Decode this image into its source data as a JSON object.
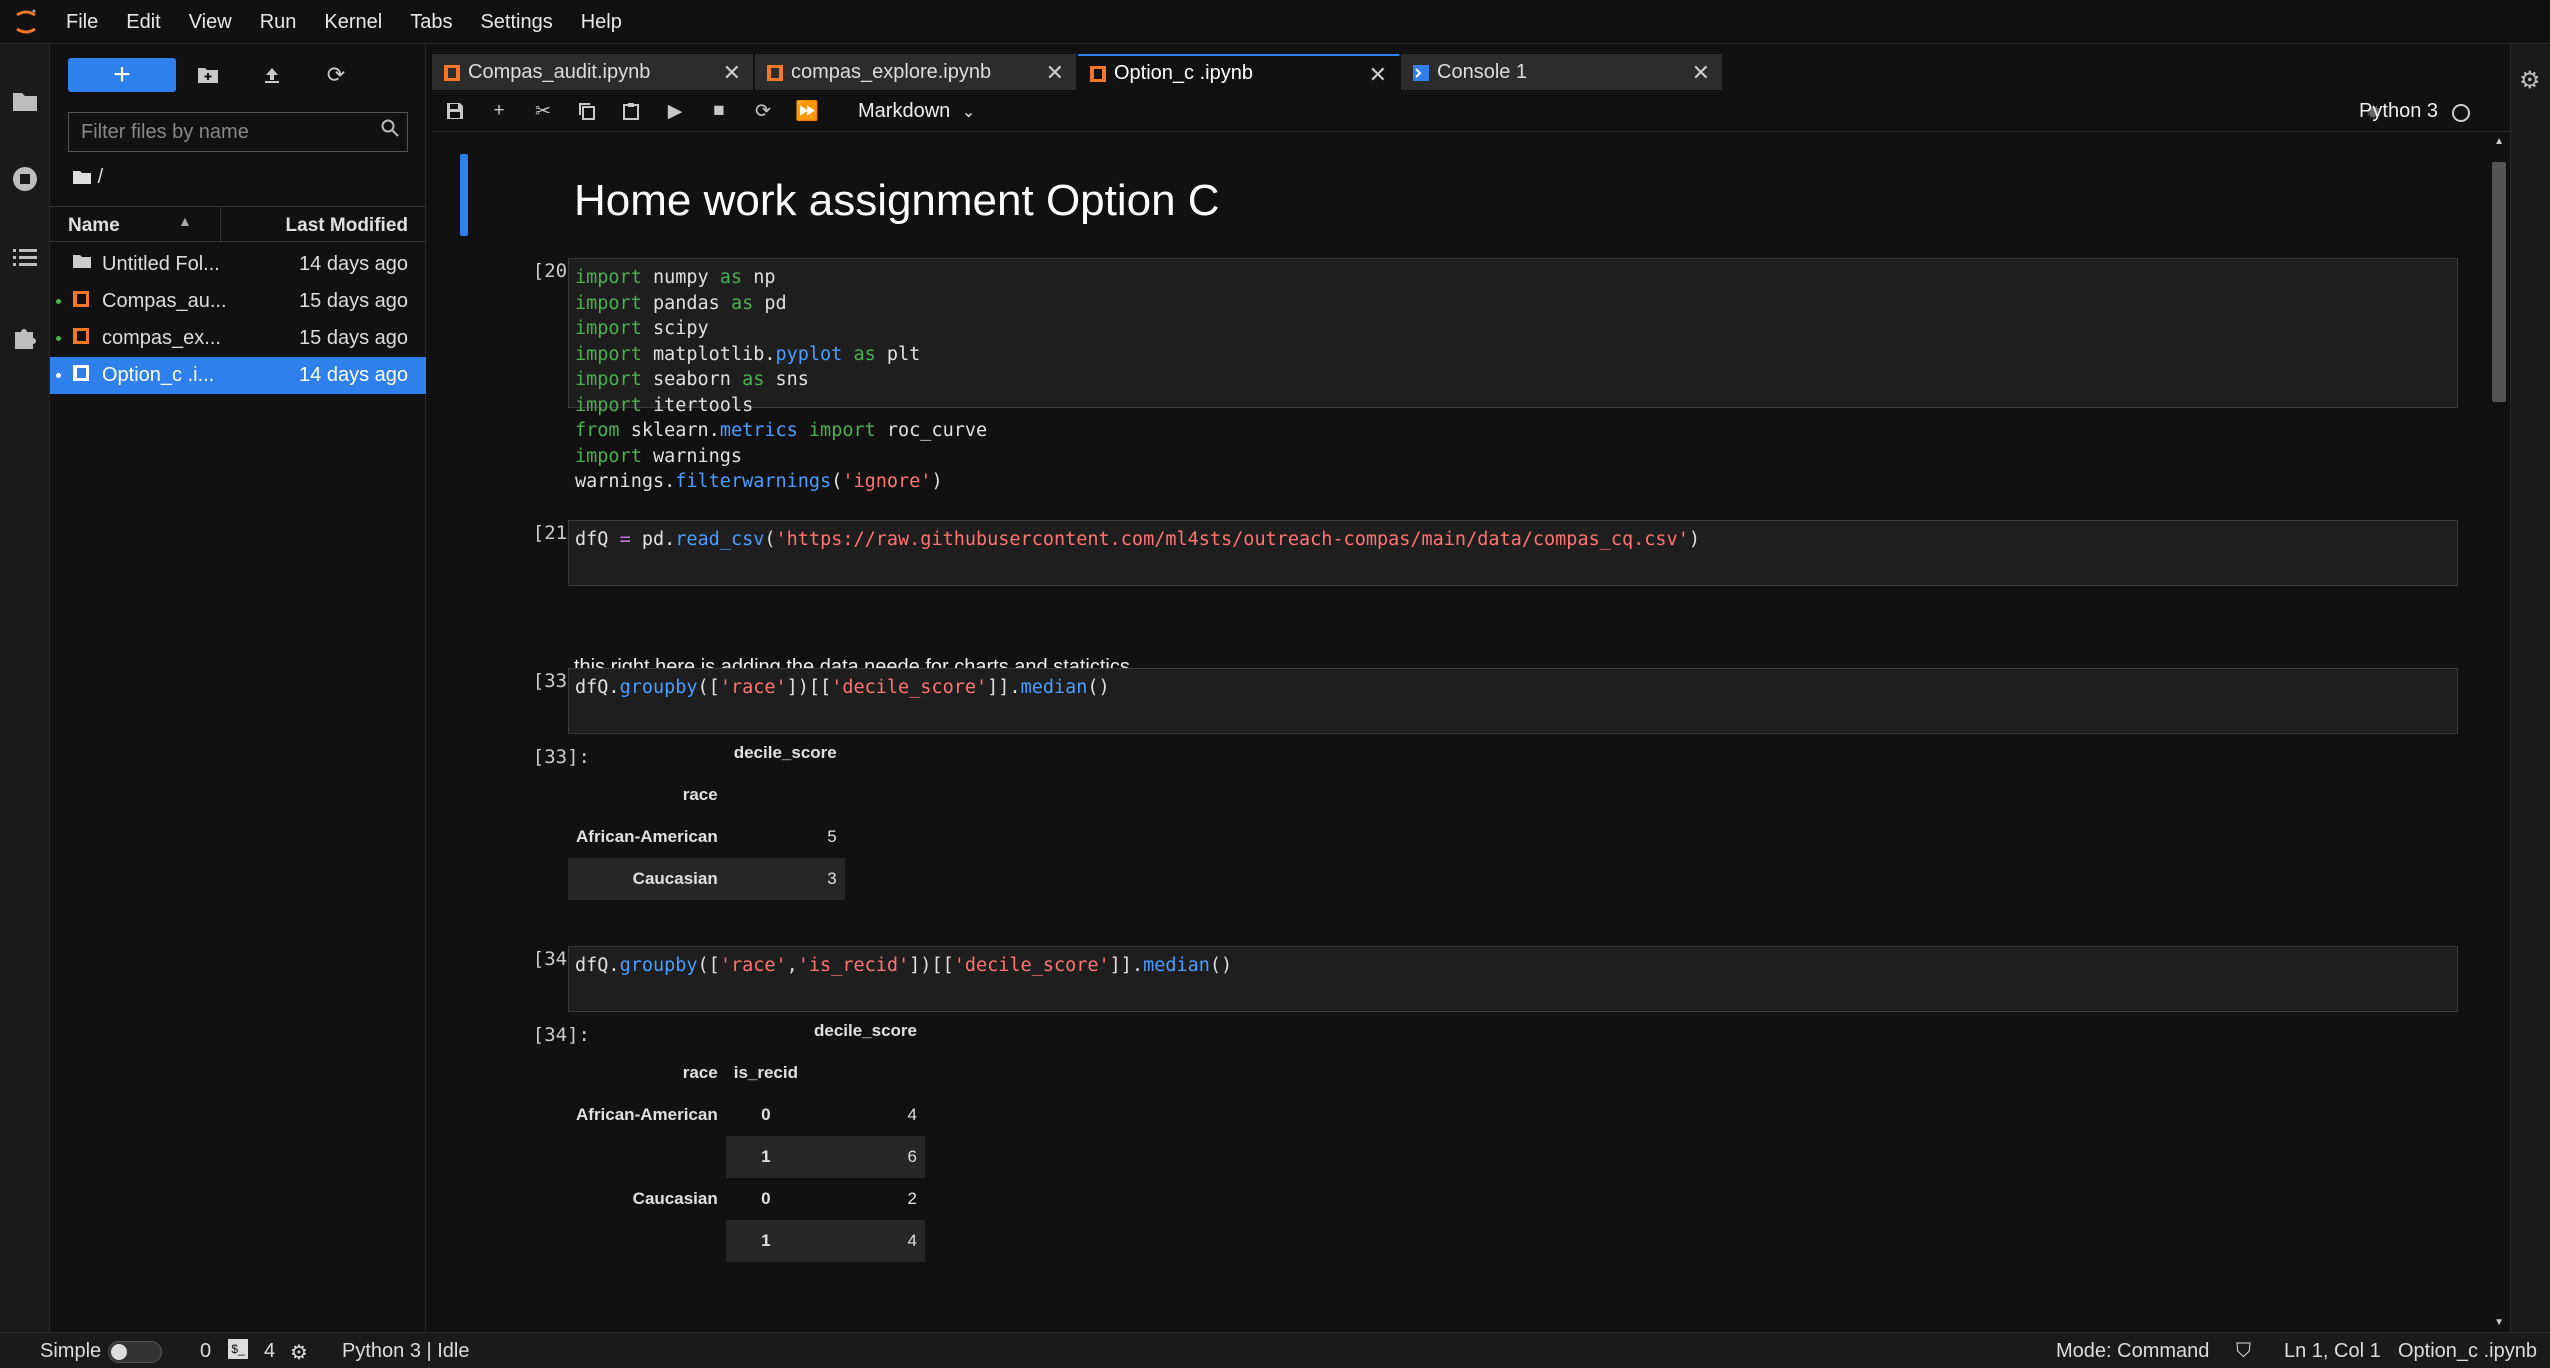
{
  "menubar": {
    "items": [
      "File",
      "Edit",
      "View",
      "Run",
      "Kernel",
      "Tabs",
      "Settings",
      "Help"
    ]
  },
  "filebrowser": {
    "filter_placeholder": "Filter files by name",
    "breadcrumb": "/",
    "col_name": "Name",
    "col_modified": "Last Modified",
    "files": [
      {
        "name": "Untitled Fol...",
        "modified": "14 days ago",
        "type": "folder"
      },
      {
        "name": "Compas_au...",
        "modified": "15 days ago",
        "type": "notebook"
      },
      {
        "name": "compas_ex...",
        "modified": "15 days ago",
        "type": "notebook"
      },
      {
        "name": "Option_c .i...",
        "modified": "14 days ago",
        "type": "notebook"
      }
    ]
  },
  "tabs": [
    {
      "label": "Compas_audit.ipynb"
    },
    {
      "label": "compas_explore.ipynb"
    },
    {
      "label": "Option_c .ipynb"
    },
    {
      "label": "Console 1"
    }
  ],
  "toolbar": {
    "cell_type": "Markdown",
    "kernel": "Python 3"
  },
  "notebook": {
    "heading": "Home work assignment Option C",
    "prompts": {
      "p20": "[20]:",
      "p21": "[21]:",
      "p33": "[33]:",
      "p33out": "[33]:",
      "p34": "[34]:",
      "p34out": "[34]:"
    },
    "markdown_text": "this right here is adding the data neede for charts and statictics",
    "table1": {
      "col": "decile_score",
      "index_name": "race",
      "rows": [
        {
          "race": "African-American",
          "value": "5"
        },
        {
          "race": "Caucasian",
          "value": "3"
        }
      ]
    },
    "table2": {
      "col": "decile_score",
      "index1": "race",
      "index2": "is_recid",
      "rows": [
        {
          "race": "African-American",
          "recid": "0",
          "value": "4"
        },
        {
          "race": "",
          "recid": "1",
          "value": "6"
        },
        {
          "race": "Caucasian",
          "recid": "0",
          "value": "2"
        },
        {
          "race": "",
          "recid": "1",
          "value": "4"
        }
      ]
    }
  },
  "statusbar": {
    "mode_label": "Simple",
    "terminals": "0",
    "kernels": "4",
    "kernel_state": "Python 3 | Idle",
    "mode": "Mode: Command",
    "position": "Ln 1, Col 1",
    "filename": "Option_c .ipynb"
  },
  "colors": {
    "accent": "#2f80ed",
    "notebook_icon": "#f37726",
    "keyword": "#4caf50",
    "string": "#ff7373",
    "function": "#4a9eff"
  }
}
